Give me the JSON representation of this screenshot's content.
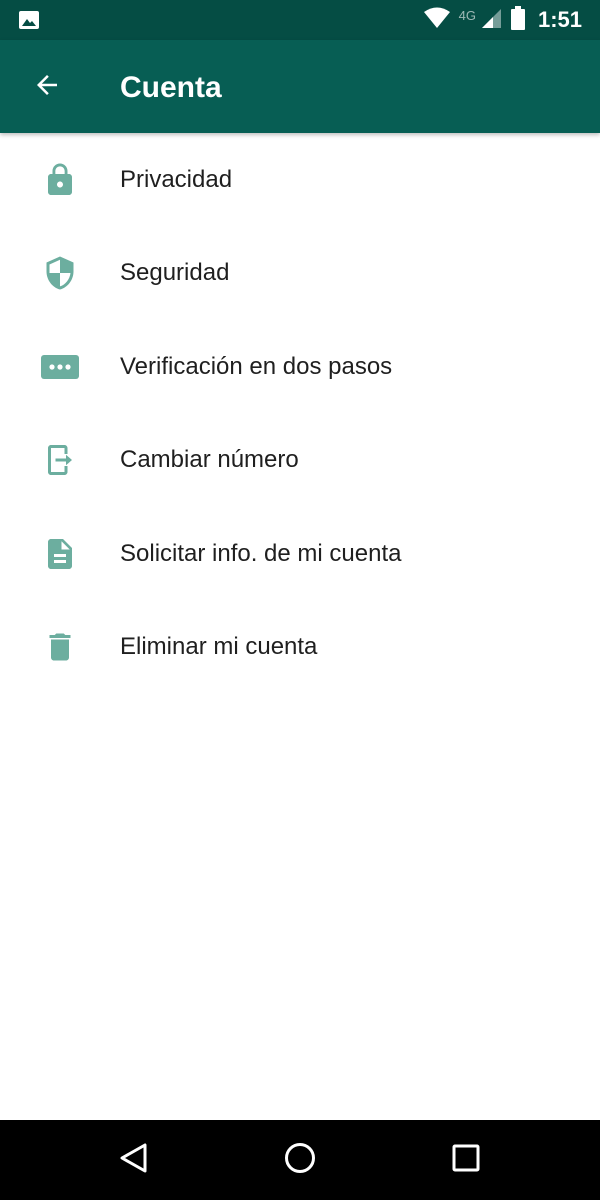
{
  "status_bar": {
    "network": "4G",
    "time": "1:51"
  },
  "header": {
    "title": "Cuenta",
    "back_icon": "arrow-left-icon"
  },
  "menu": {
    "items": [
      {
        "label": "Privacidad",
        "icon": "lock-icon"
      },
      {
        "label": "Seguridad",
        "icon": "shield-icon"
      },
      {
        "label": "Verificación en dos pasos",
        "icon": "password-dots-icon"
      },
      {
        "label": "Cambiar número",
        "icon": "change-number-icon"
      },
      {
        "label": "Solicitar info. de mi cuenta",
        "icon": "document-icon"
      },
      {
        "label": "Eliminar mi cuenta",
        "icon": "trash-icon"
      }
    ]
  },
  "navigation": {
    "back_icon": "triangle-back-icon",
    "home_icon": "circle-home-icon",
    "recents_icon": "square-recents-icon"
  },
  "colors": {
    "status_bar": "#054d44",
    "app_bar": "#075e54",
    "icon": "#6cae9f",
    "text": "#1f1f1f"
  }
}
